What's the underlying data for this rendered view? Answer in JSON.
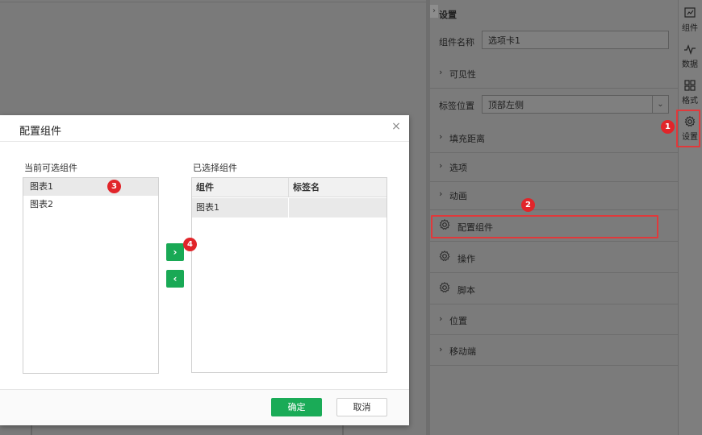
{
  "panel": {
    "title": "设置",
    "component_name_label": "组件名称",
    "component_name_value": "选项卡1",
    "tab_position_label": "标签位置",
    "tab_position_value": "顶部左侧",
    "rows": [
      {
        "label": "可见性",
        "icon": "chevron-right-icon"
      },
      {
        "label": "填充距离",
        "icon": "chevron-right-icon"
      },
      {
        "label": "选项",
        "icon": "chevron-right-icon"
      },
      {
        "label": "动画",
        "icon": "chevron-right-icon"
      },
      {
        "label": "配置组件",
        "icon": "gear-icon"
      },
      {
        "label": "操作",
        "icon": "gear-icon"
      },
      {
        "label": "脚本",
        "icon": "gear-icon"
      },
      {
        "label": "位置",
        "icon": "chevron-right-icon"
      },
      {
        "label": "移动端",
        "icon": "chevron-right-icon"
      }
    ]
  },
  "rail": {
    "items": [
      {
        "label": "组件",
        "icon": "component-icon"
      },
      {
        "label": "数据",
        "icon": "data-icon"
      },
      {
        "label": "格式",
        "icon": "format-icon"
      },
      {
        "label": "设置",
        "icon": "gear-icon"
      }
    ]
  },
  "badges": [
    "1",
    "2",
    "3",
    "4"
  ],
  "dialog": {
    "title": "配置组件",
    "available_label": "当前可选组件",
    "available_items": [
      "图表1",
      "图表2"
    ],
    "selected_label": "已选择组件",
    "table_headers": [
      "组件",
      "标签名"
    ],
    "table_rows": [
      [
        "图表1",
        ""
      ]
    ],
    "move_right": "›",
    "move_left": "‹",
    "confirm": "确定",
    "cancel": "取消"
  },
  "colors": {
    "accent_green": "#1aab57",
    "highlight_red": "#e0393b",
    "badge_red": "#e1252a"
  }
}
